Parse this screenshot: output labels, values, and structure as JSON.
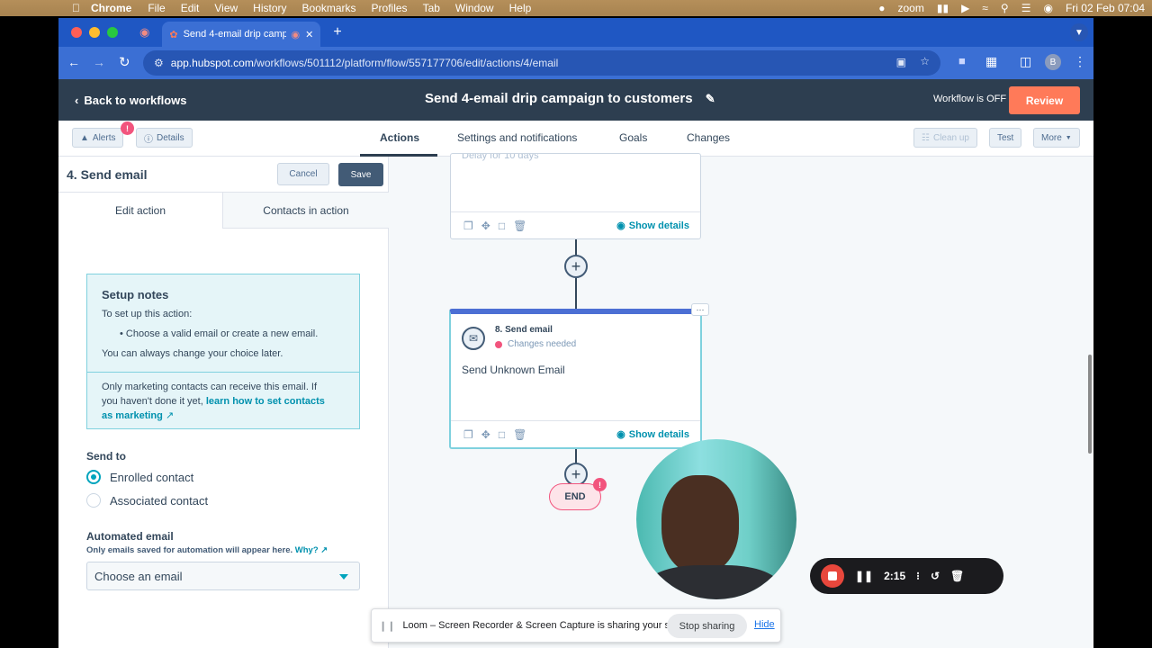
{
  "os_menu": {
    "app": "Chrome",
    "items": [
      "File",
      "Edit",
      "View",
      "History",
      "Bookmarks",
      "Profiles",
      "Tab",
      "Window",
      "Help"
    ],
    "status": {
      "zoom": "zoom",
      "datetime": "Fri 02 Feb  07:04",
      "notif_count": "3"
    }
  },
  "browser": {
    "tab_title": "Send 4-email drip campa",
    "url_host": "app.hubspot.com",
    "url_path": "/workflows/501112/platform/flow/557177706/edit/actions/4/email",
    "avatar_letter": "B"
  },
  "header": {
    "back_label": "Back to workflows",
    "title": "Send 4-email drip campaign to customers",
    "status": "Workflow is OFF",
    "review_label": "Review"
  },
  "subnav": {
    "alerts_label": "Alerts",
    "alerts_badge": "!",
    "details_label": "Details",
    "tabs": [
      "Actions",
      "Settings and notifications",
      "Goals",
      "Changes"
    ],
    "active_tab": "Actions",
    "cleanup_label": "Clean up",
    "test_label": "Test",
    "more_label": "More"
  },
  "panel": {
    "title": "4. Send email",
    "cancel_label": "Cancel",
    "save_label": "Save",
    "tab_edit": "Edit action",
    "tab_contacts": "Contacts in action",
    "notes": {
      "heading": "Setup notes",
      "intro": "To set up this action:",
      "bullet": "Choose a valid email or create a new email.",
      "change": "You can always change your choice later.",
      "marketing_1": "Only marketing contacts can receive this email. If",
      "marketing_2": "you haven't done it yet,",
      "marketing_link_1": "learn how to set contacts",
      "marketing_link_2": "as marketing"
    },
    "send_to_label": "Send to",
    "send_options": [
      "Enrolled contact",
      "Associated contact"
    ],
    "selected_option": "Enrolled contact",
    "automated_label": "Automated email",
    "automated_hint": "Only emails saved for automation will appear here.",
    "why_label": "Why?",
    "select_value": "Choose an email"
  },
  "canvas": {
    "top_card_partial_text": "Delay for 10 days",
    "show_details_label": "Show details",
    "step_title": "8. Send email",
    "step_status": "Changes needed",
    "step_body": "Send Unknown Email",
    "end_label": "END",
    "end_badge": "!"
  },
  "recorder": {
    "time": "2:15"
  },
  "share_bar": {
    "message": "Loom – Screen Recorder & Screen Capture is sharing your screen.",
    "stop_label": "Stop sharing",
    "hide_label": "Hide"
  },
  "colors": {
    "brand_dark": "#2d3e50",
    "review": "#ff7a59",
    "accent_teal": "#00a4bd",
    "link": "#0091ae",
    "error": "#f2547d",
    "chrome_blue": "#3b6fd4"
  }
}
